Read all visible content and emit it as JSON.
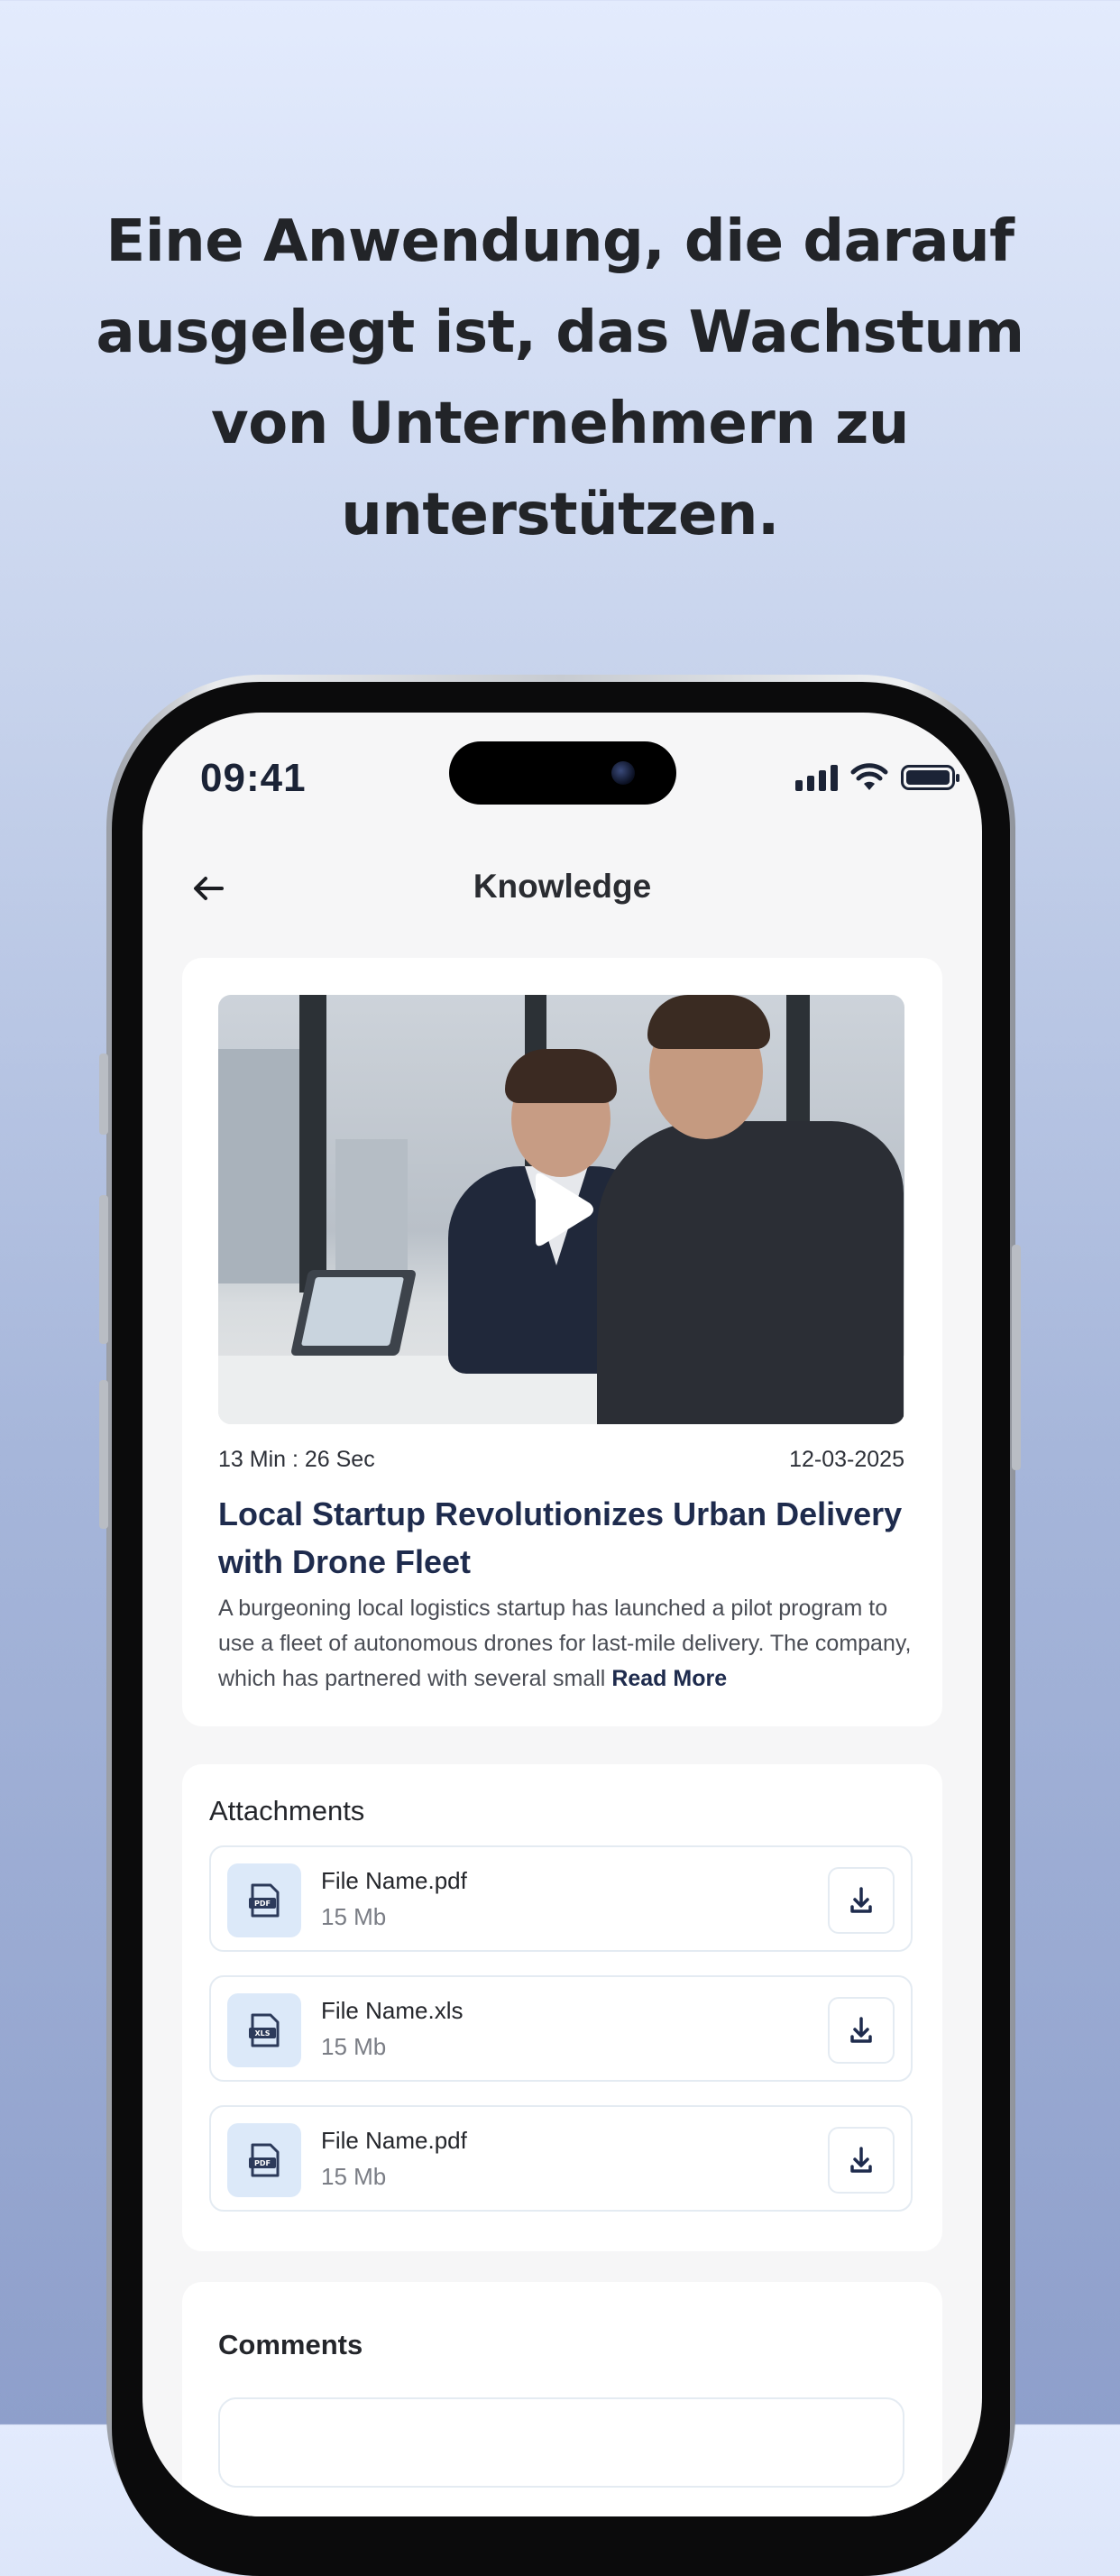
{
  "headline": "Eine Anwendung, die darauf\nausgelegt ist, das Wachstum\nvon Unternehmern zu\nunterstützen.",
  "status_bar": {
    "time": "09:41"
  },
  "header": {
    "title": "Knowledge",
    "back_icon": "arrow-left-icon"
  },
  "video_card": {
    "duration": "13 Min : 26 Sec",
    "date": "12-03-2025",
    "title": "Local Startup Revolutionizes Urban Delivery with Drone Fleet",
    "body": "A burgeoning local logistics startup has launched a pilot program to use a fleet of autonomous drones for last-mile delivery. The company, which has partnered with several small",
    "read_more": "Read More",
    "play_icon": "play-icon"
  },
  "attachments": {
    "title": "Attachments",
    "files": [
      {
        "name": "File Name.pdf",
        "size": "15 Mb",
        "type": "PDF"
      },
      {
        "name": "File Name.xls",
        "size": "15 Mb",
        "type": "XLS"
      },
      {
        "name": "File Name.pdf",
        "size": "15 Mb",
        "type": "PDF"
      }
    ],
    "download_icon": "download-icon"
  },
  "comments": {
    "title": "Comments"
  },
  "colors": {
    "accent_navy": "#1e2b4d",
    "file_icon_bg": "#dce9f9",
    "background_top": "#e3ebfd",
    "background_bottom": "#8e9fcb"
  }
}
